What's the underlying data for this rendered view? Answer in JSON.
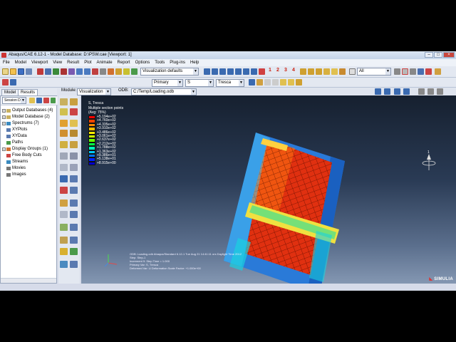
{
  "window": {
    "title": "Abaqus/CAE 6.12-1 - Model Database: D:\\PSW.cae [Viewport: 1]"
  },
  "menu": [
    "File",
    "Model",
    "Viewport",
    "View",
    "Result",
    "Plot",
    "Animate",
    "Report",
    "Options",
    "Tools",
    "Plug-ins",
    "Help"
  ],
  "toolbar": {
    "view_combo": "Visualization defaults",
    "primary_combo": "Primary",
    "variable_combo": "S",
    "invariant_combo": "Tresca",
    "numbers": [
      "1",
      "2",
      "3",
      "4"
    ],
    "selection_combo": "All"
  },
  "module_bar": {
    "module_label": "Module:",
    "module_value": "Visualization",
    "odb_label": "ODB:",
    "odb_value": "C:/Temp/Loading.odb"
  },
  "left_tabs": [
    "Model",
    "Results"
  ],
  "session_combo": "Session Da",
  "tree": [
    {
      "label": "Output Databases (4)",
      "expand": "+"
    },
    {
      "label": "Model Database (2)",
      "expand": "+"
    },
    {
      "label": "Spectrums (7)",
      "expand": "+"
    },
    {
      "label": "XYPlots",
      "expand": ""
    },
    {
      "label": "XYData",
      "expand": ""
    },
    {
      "label": "Paths",
      "expand": ""
    },
    {
      "label": "Display Groups (1)",
      "expand": "+"
    },
    {
      "label": "Free Body Cuts",
      "expand": ""
    },
    {
      "label": "Streams",
      "expand": ""
    },
    {
      "label": "Movies",
      "expand": ""
    },
    {
      "label": "Images",
      "expand": ""
    }
  ],
  "legend": {
    "title": "S, Tresca",
    "subtitle": "Multiple section points",
    "avg": "(Avg: 75%)",
    "colors": [
      "#ff0000",
      "#ff4400",
      "#ff8800",
      "#ffbb00",
      "#ffee00",
      "#ccff00",
      "#66ff00",
      "#00ff44",
      "#00ffbb",
      "#00ccff",
      "#0077ff",
      "#0022ff",
      "#0000cc"
    ],
    "values": [
      "+5.194e+02",
      "+4.760e+02",
      "+4.335e+02",
      "+3.910e+02",
      "+3.486e+02",
      "+3.061e+02",
      "+2.637e+02",
      "+2.212e+02",
      "+1.788e+02",
      "+1.363e+02",
      "+9.386e+01",
      "+5.138e+01",
      "+8.915e+00"
    ]
  },
  "status_lines": [
    "ODB: Loading.odb    Abaqus/Standard 6.12-1   Tue Aug 21 14:41:11 ors Daylight Time 2012",
    "Step: Step-1",
    "Increment 9:  Step Time =    1.000",
    "Primary Var: S, Tresca",
    "Deformed Var: U   Deformation Scale Factor: +1.000e+00"
  ],
  "brand": "SIMULIA"
}
